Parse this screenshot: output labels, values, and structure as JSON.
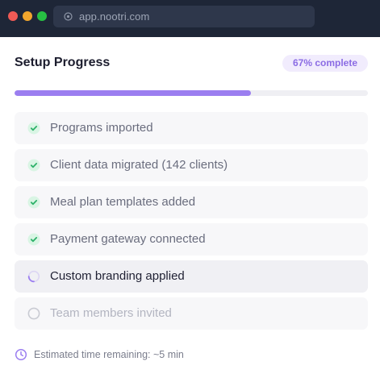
{
  "browser": {
    "url": "app.nootri.com",
    "url_icon": "site-info-icon"
  },
  "setup": {
    "title": "Setup Progress",
    "badge": "67% complete",
    "progress_fraction": 0.67,
    "accent_color": "#9b7ef0",
    "steps": [
      {
        "label": "Programs imported",
        "status": "done",
        "icon": "check-circle-icon"
      },
      {
        "label": "Client data migrated (142 clients)",
        "status": "done",
        "icon": "check-circle-icon"
      },
      {
        "label": "Meal plan templates added",
        "status": "done",
        "icon": "check-circle-icon"
      },
      {
        "label": "Payment gateway connected",
        "status": "done",
        "icon": "check-circle-icon"
      },
      {
        "label": "Custom branding applied",
        "status": "in-progress",
        "icon": "spinner-icon"
      },
      {
        "label": "Team members invited",
        "status": "pending",
        "icon": "empty-circle-icon"
      }
    ],
    "eta": "Estimated time remaining: ~5 min",
    "eta_icon": "clock-icon"
  },
  "colors": {
    "done": "#2eb26a",
    "done_bg": "#d9f5e4",
    "spinner": "#9b7ef0",
    "pending": "#c9cbd3",
    "chrome": "#1e2637"
  }
}
